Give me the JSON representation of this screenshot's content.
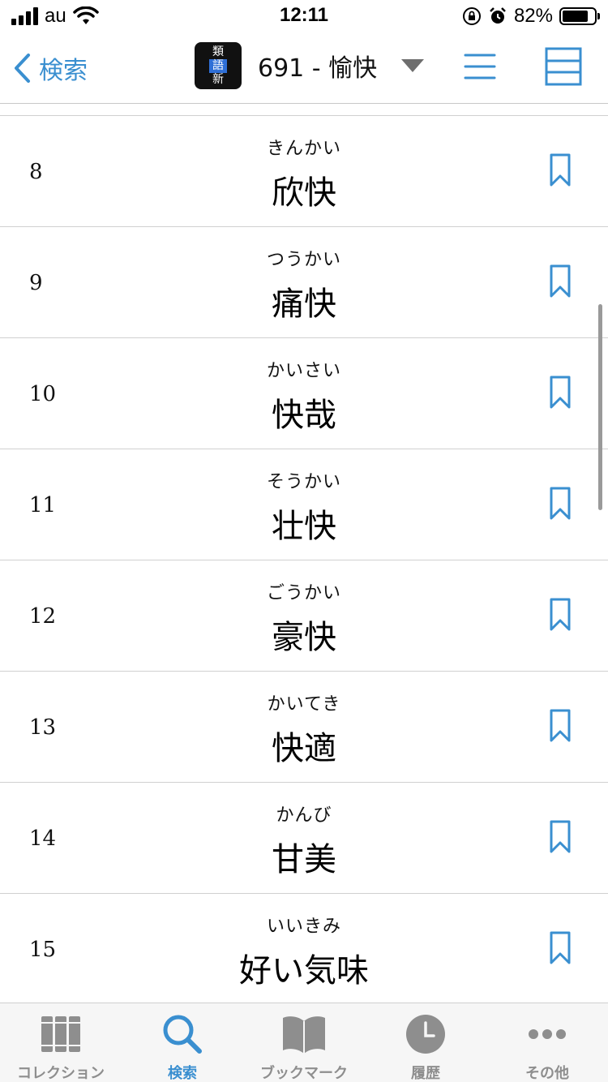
{
  "status_bar": {
    "carrier": "au",
    "time": "12:11",
    "battery_percent": "82%",
    "battery_level": 0.82
  },
  "nav": {
    "back_label": "検索",
    "title": "691 - 愉快",
    "logo_chars": [
      "類",
      "語",
      "新"
    ],
    "accent_color": "#3a8fd0"
  },
  "items": [
    {
      "num": "8",
      "reading": "きんかい",
      "word": "欣快"
    },
    {
      "num": "9",
      "reading": "つうかい",
      "word": "痛快"
    },
    {
      "num": "10",
      "reading": "かいさい",
      "word": "快哉"
    },
    {
      "num": "11",
      "reading": "そうかい",
      "word": "壮快"
    },
    {
      "num": "12",
      "reading": "ごうかい",
      "word": "豪快"
    },
    {
      "num": "13",
      "reading": "かいてき",
      "word": "快適"
    },
    {
      "num": "14",
      "reading": "かんび",
      "word": "甘美"
    },
    {
      "num": "15",
      "reading": "いいきみ",
      "word": "好い気味"
    }
  ],
  "tabs": [
    {
      "label": "コレクション",
      "icon": "books-icon",
      "active": false
    },
    {
      "label": "検索",
      "icon": "search-icon",
      "active": true
    },
    {
      "label": "ブックマーク",
      "icon": "open-book-icon",
      "active": false
    },
    {
      "label": "履歴",
      "icon": "clock-icon",
      "active": false
    },
    {
      "label": "その他",
      "icon": "more-icon",
      "active": false
    }
  ]
}
